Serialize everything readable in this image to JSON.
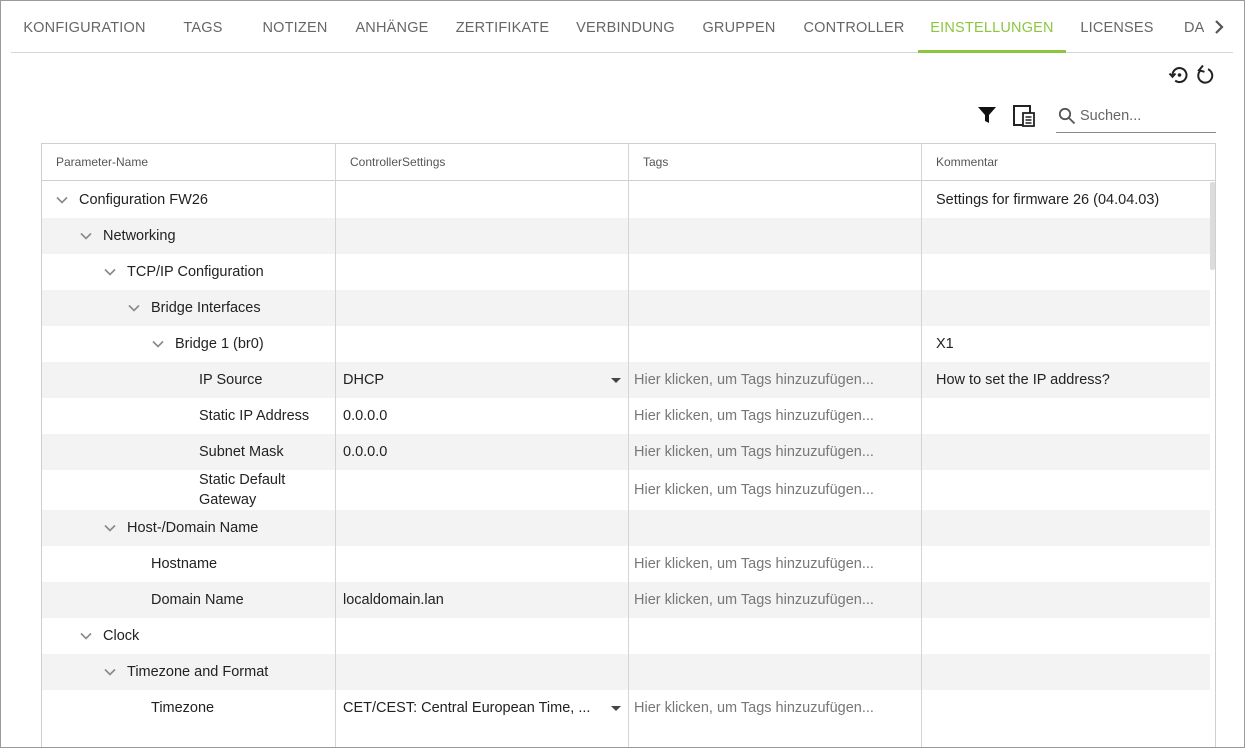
{
  "tabs": [
    {
      "label": "KONFIGURATION"
    },
    {
      "label": "TAGS"
    },
    {
      "label": "NOTIZEN"
    },
    {
      "label": "ANHÄNGE"
    },
    {
      "label": "ZERTIFIKATE"
    },
    {
      "label": "VERBINDUNG"
    },
    {
      "label": "GRUPPEN"
    },
    {
      "label": "CONTROLLER"
    },
    {
      "label": "EINSTELLUNGEN"
    },
    {
      "label": "LICENSES"
    },
    {
      "label": "DA"
    }
  ],
  "active_tab": "EINSTELLUNGEN",
  "accent_color": "#8cc63f",
  "toolbar": {
    "restore_icon": "restore-history-icon",
    "reset_icon": "reset-icon",
    "filter_icon": "filter-icon",
    "columns_icon": "column-chooser-icon",
    "search_placeholder": "Suchen..."
  },
  "grid": {
    "columns": [
      "Parameter-Name",
      "ControllerSettings",
      "Tags",
      "Kommentar"
    ],
    "tag_placeholder": "Hier klicken, um Tags hinzuzufügen...",
    "rows": [
      {
        "name": "Configuration FW26",
        "level": 0,
        "expandable": true,
        "value": "",
        "comment": "Settings for firmware 26 (04.04.03)"
      },
      {
        "name": "Networking",
        "level": 1,
        "expandable": true,
        "value": "",
        "comment": ""
      },
      {
        "name": "TCP/IP Configuration",
        "level": 2,
        "expandable": true,
        "value": "",
        "comment": ""
      },
      {
        "name": "Bridge Interfaces",
        "level": 3,
        "expandable": true,
        "value": "",
        "comment": ""
      },
      {
        "name": "Bridge 1 (br0)",
        "level": 4,
        "expandable": true,
        "value": "",
        "comment": "X1"
      },
      {
        "name": "IP Source",
        "level": 5,
        "expandable": false,
        "value": "DHCP",
        "dropdown": true,
        "tags": true,
        "comment": "How to set the IP address?"
      },
      {
        "name": "Static IP Address",
        "level": 5,
        "expandable": false,
        "value": "0.0.0.0",
        "tags": true,
        "comment": ""
      },
      {
        "name": "Subnet Mask",
        "level": 5,
        "expandable": false,
        "value": "0.0.0.0",
        "tags": true,
        "comment": ""
      },
      {
        "name": "Static Default Gateway",
        "level": 5,
        "expandable": false,
        "value": "",
        "tags": true,
        "comment": "",
        "tall": true
      },
      {
        "name": "Host-/Domain Name",
        "level": 2,
        "expandable": true,
        "value": "",
        "comment": ""
      },
      {
        "name": "Hostname",
        "level": 3,
        "expandable": false,
        "value": "",
        "tags": true,
        "comment": ""
      },
      {
        "name": "Domain Name",
        "level": 3,
        "expandable": false,
        "value": "localdomain.lan",
        "tags": true,
        "comment": ""
      },
      {
        "name": "Clock",
        "level": 1,
        "expandable": true,
        "value": "",
        "comment": ""
      },
      {
        "name": "Timezone and Format",
        "level": 2,
        "expandable": true,
        "value": "",
        "comment": ""
      },
      {
        "name": "Timezone",
        "level": 3,
        "expandable": false,
        "value": "CET/CEST: Central European Time, ...",
        "dropdown": true,
        "tags": true,
        "comment": ""
      }
    ]
  }
}
